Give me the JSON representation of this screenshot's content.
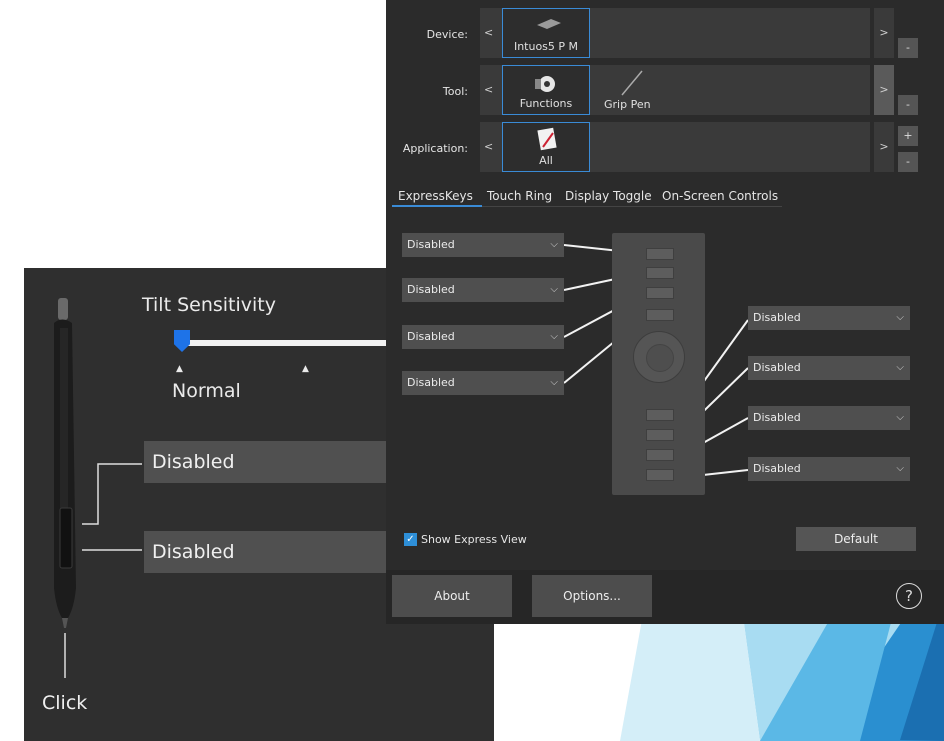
{
  "pen_panel": {
    "tilt_label": "Tilt Sensitivity",
    "tilt_value": "Normal",
    "tilt_level": 0,
    "upper_button": "Disabled",
    "lower_button": "Disabled",
    "click_label": "Click"
  },
  "device_row": {
    "label": "Device:",
    "nav_prev": "<",
    "nav_next": ">",
    "selected": "Intuos5 P M",
    "minus": "-"
  },
  "tool_row": {
    "label": "Tool:",
    "nav_prev": "<",
    "nav_next": ">",
    "selected": "Functions",
    "other": "Grip Pen",
    "minus": "-"
  },
  "app_row": {
    "label": "Application:",
    "nav_prev": "<",
    "nav_next": ">",
    "selected": "All",
    "plus": "+",
    "minus": "-"
  },
  "tabs": [
    "ExpressKeys",
    "Touch Ring",
    "Display Toggle",
    "On-Screen Controls"
  ],
  "express_keys": {
    "left": [
      "Disabled",
      "Disabled",
      "Disabled",
      "Disabled"
    ],
    "right": [
      "Disabled",
      "Disabled",
      "Disabled",
      "Disabled"
    ]
  },
  "show_express_view": {
    "label": "Show Express View",
    "checked": true
  },
  "buttons": {
    "default": "Default",
    "about": "About",
    "options": "Options...",
    "help": "?"
  },
  "colors": {
    "accent": "#3a8bd6",
    "panel": "#2b2b2b",
    "checkbox": "#2e8fd8",
    "slider_thumb": "#1e73e8"
  }
}
